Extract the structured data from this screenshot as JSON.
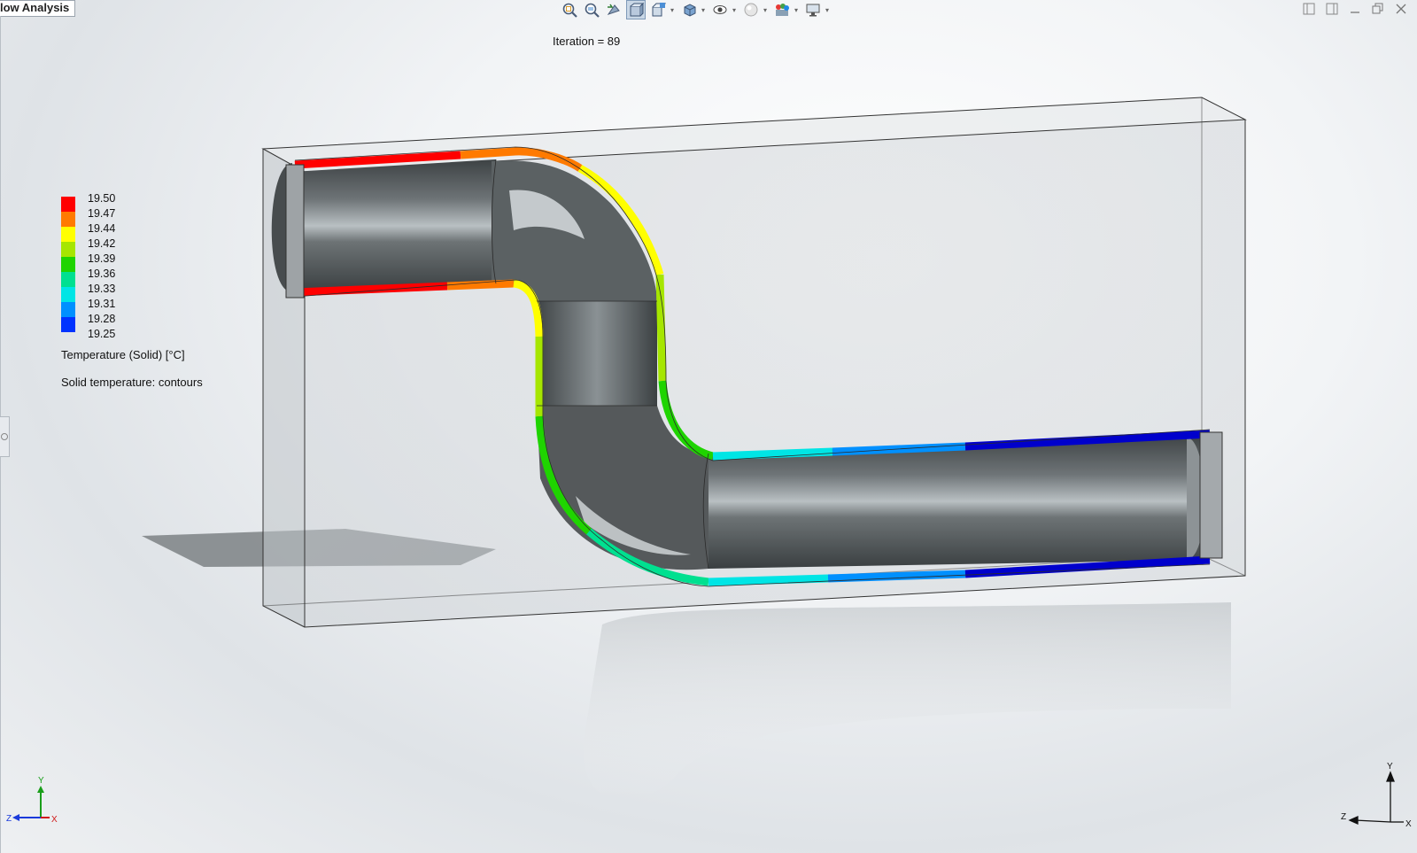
{
  "window": {
    "tab_title": "low Analysis"
  },
  "toolbar": {
    "icons": [
      "zoom-to-fit-icon",
      "zoom-area-icon",
      "previous-view-icon",
      "section-view-icon",
      "view-orientation-icon",
      "display-style-icon",
      "hide-show-items-icon",
      "edit-appearance-icon",
      "apply-scene-icon",
      "view-settings-icon"
    ]
  },
  "window_controls": [
    "tile-left-icon",
    "tile-right-icon",
    "minimize-icon",
    "restore-icon",
    "close-icon"
  ],
  "status": {
    "iteration": "Iteration = 89"
  },
  "legend": {
    "ticks": [
      "19.50",
      "19.47",
      "19.44",
      "19.42",
      "19.39",
      "19.36",
      "19.33",
      "19.31",
      "19.28",
      "19.25"
    ],
    "colors": [
      "#ff0000",
      "#ff7a00",
      "#ffff00",
      "#a6e600",
      "#1fd400",
      "#00e090",
      "#00e5e5",
      "#0090ff",
      "#0033ff",
      "#0000cc"
    ],
    "title": "Temperature (Solid) [°C]",
    "subtitle": "Solid temperature: contours"
  },
  "triad_small": {
    "x": "X",
    "y": "Y",
    "z": "Z"
  },
  "triad_large": {
    "x": "X",
    "y": "Y",
    "z": "Z"
  }
}
